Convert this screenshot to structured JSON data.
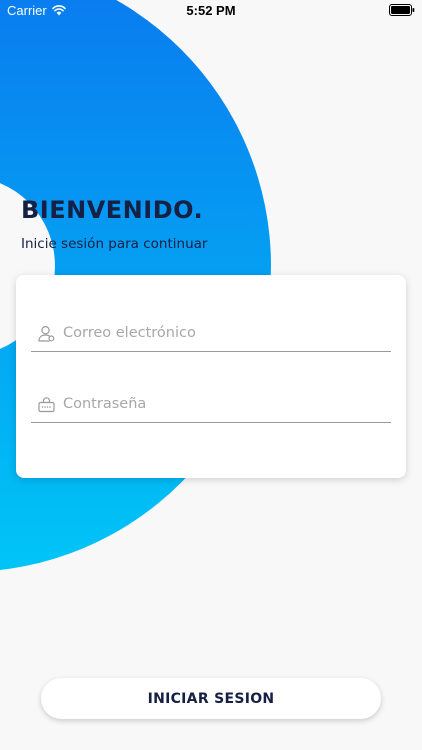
{
  "status_bar": {
    "carrier": "Carrier",
    "time": "5:52 PM"
  },
  "welcome": {
    "title": "BIENVENIDO.",
    "subtitle": "Inicie sesión para continuar"
  },
  "form": {
    "email": {
      "placeholder": "Correo electrónico",
      "value": "",
      "icon": "user-icon"
    },
    "password": {
      "placeholder": "Contraseña",
      "value": "",
      "icon": "keyboard-icon"
    }
  },
  "actions": {
    "login_label": "INICIAR SESION"
  },
  "colors": {
    "accent_top": "#0a78ef",
    "accent_bottom": "#00c5f6",
    "text_primary": "#152044",
    "background": "#f8f8f8"
  }
}
